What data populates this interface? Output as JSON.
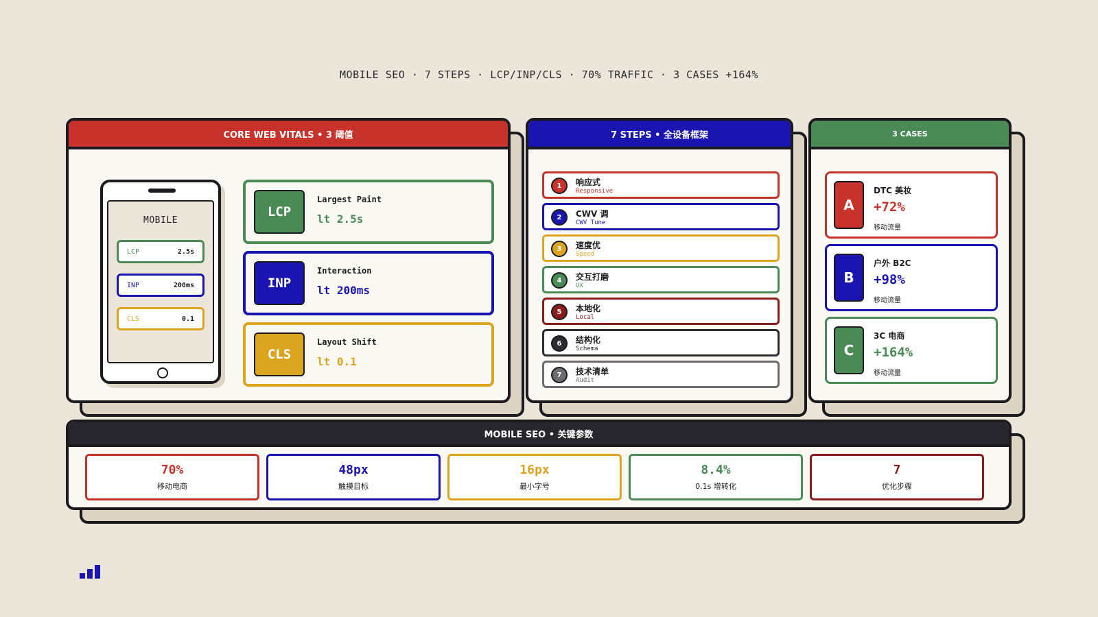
{
  "headline": "MOBILE SEO · 7 STEPS · LCP/INP/CLS · 70% TRAFFIC · 3 CASES +164%",
  "colors": {
    "red": "#c7322b",
    "blue": "#1a14b0",
    "yellow": "#dca520",
    "green": "#4a8a55",
    "dark_red": "#8a1c1a",
    "black": "#2b2b31",
    "background": "#ebe6d9"
  },
  "vitals": {
    "title": "CORE WEB VITALS • 3 阈值",
    "phone": {
      "title": "MOBILE",
      "rows": [
        {
          "key": "LCP",
          "value": "2.5s"
        },
        {
          "key": "INP",
          "value": "200ms"
        },
        {
          "key": "CLS",
          "value": "0.1"
        }
      ]
    },
    "metrics": [
      {
        "badge": "LCP",
        "name": "Largest Paint",
        "value": "lt 2.5s"
      },
      {
        "badge": "INP",
        "name": "Interaction",
        "value": "lt 200ms"
      },
      {
        "badge": "CLS",
        "name": "Layout Shift",
        "value": "lt 0.1"
      }
    ]
  },
  "steps": {
    "title": "7 STEPS • 全设备框架",
    "items": [
      {
        "num": "1",
        "title": "响应式",
        "sub": "Responsive"
      },
      {
        "num": "2",
        "title": "CWV 调",
        "sub": "CWV Tune"
      },
      {
        "num": "3",
        "title": "速度优",
        "sub": "Speed"
      },
      {
        "num": "4",
        "title": "交互打磨",
        "sub": "UX"
      },
      {
        "num": "5",
        "title": "本地化",
        "sub": "Local"
      },
      {
        "num": "6",
        "title": "结构化",
        "sub": "Schema"
      },
      {
        "num": "7",
        "title": "技术清单",
        "sub": "Audit"
      }
    ]
  },
  "cases": {
    "title": "3 CASES",
    "items": [
      {
        "letter": "A",
        "name": "DTC 美妆",
        "pct": "+72%",
        "label": "移动流量"
      },
      {
        "letter": "B",
        "name": "户外 B2C",
        "pct": "+98%",
        "label": "移动流量"
      },
      {
        "letter": "C",
        "name": "3C 电商",
        "pct": "+164%",
        "label": "移动流量"
      }
    ]
  },
  "params": {
    "title": "MOBILE SEO • 关键参数",
    "items": [
      {
        "value": "70%",
        "label": "移动电商"
      },
      {
        "value": "48px",
        "label": "触摸目标"
      },
      {
        "value": "16px",
        "label": "最小字号"
      },
      {
        "value": "8.4%",
        "label": "0.1s 增转化"
      },
      {
        "value": "7",
        "label": "优化步骤"
      }
    ]
  },
  "logo_icon": "bar-chart-logo-icon"
}
